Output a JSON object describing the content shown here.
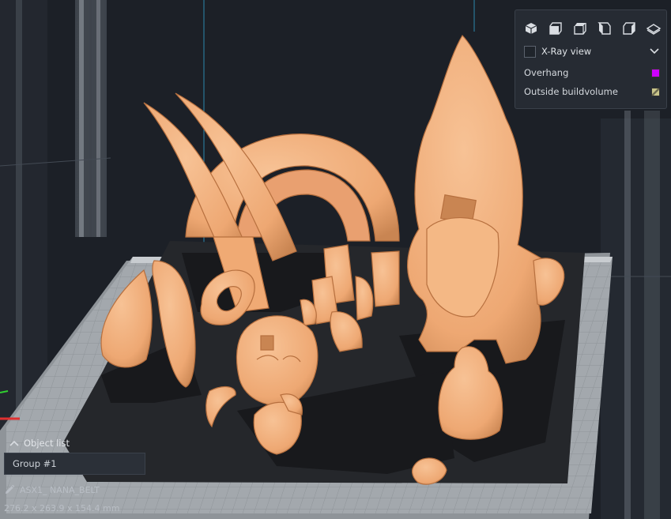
{
  "view_panel": {
    "view_buttons": [
      "3d-view-icon",
      "front-view-icon",
      "top-view-icon",
      "left-view-icon",
      "right-view-icon",
      "layflat-view-icon"
    ],
    "xray": {
      "label": "X-Ray view",
      "checked": false
    },
    "legend": [
      {
        "label": "Overhang",
        "color": "#cc00ff"
      },
      {
        "label": "Outside buildvolume",
        "color": "#9a9a6a"
      }
    ]
  },
  "object_list": {
    "header": "Object list",
    "group_name": "Group #1",
    "selected_object": "ASX1_ NANA_BELT",
    "dimensions": "276.2 x 263.9 x 154.4 mm"
  },
  "colors": {
    "model": "#f2b07e",
    "model_shade": "#c77d4c",
    "plate": "#9ea3a8",
    "background": "#1b1f25",
    "shadow": "#1d1f23"
  }
}
